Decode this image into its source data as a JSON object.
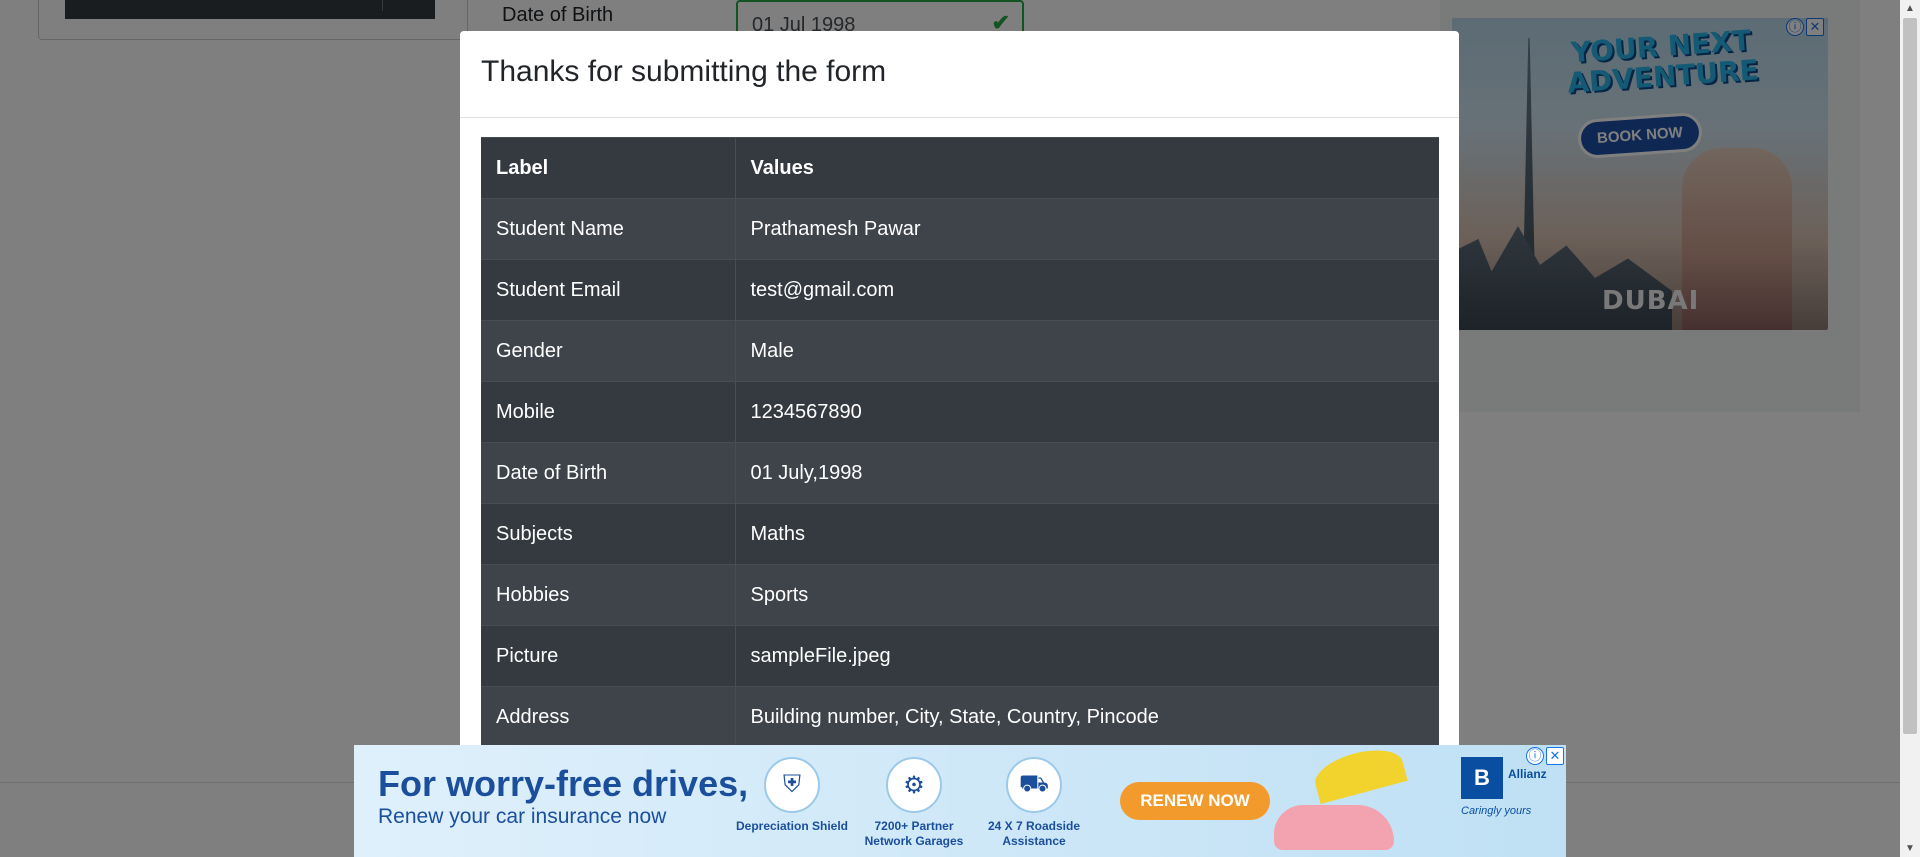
{
  "background": {
    "field_label": "Date of Birth",
    "date_value": "01 Jul 1998"
  },
  "modal": {
    "title": "Thanks for submitting the form",
    "table": {
      "headers": [
        "Label",
        "Values"
      ],
      "rows": [
        {
          "label": "Student Name",
          "value": "Prathamesh Pawar"
        },
        {
          "label": "Student Email",
          "value": "test@gmail.com"
        },
        {
          "label": "Gender",
          "value": "Male"
        },
        {
          "label": "Mobile",
          "value": "1234567890"
        },
        {
          "label": "Date of Birth",
          "value": "01 July,1998"
        },
        {
          "label": "Subjects",
          "value": "Maths"
        },
        {
          "label": "Hobbies",
          "value": "Sports"
        },
        {
          "label": "Picture",
          "value": "sampleFile.jpeg"
        },
        {
          "label": "Address",
          "value": "Building number, City, State, Country, Pincode"
        }
      ]
    }
  },
  "ad_right": {
    "headline": "YOUR NEXT ADVENTURE",
    "button": "BOOK NOW",
    "brand": "DUBAI"
  },
  "ad_bottom": {
    "headline": "For worry-free drives,",
    "subline": "Renew your car insurance now",
    "features": [
      "Depreciation Shield",
      "7200+ Partner Network Garages",
      "24 X 7 Roadside Assistance"
    ],
    "button": "RENEW NOW",
    "logo_text": "B",
    "partner": "Allianz",
    "tagline": "Caringly yours"
  },
  "icons": {
    "ad_info": "ⓘ",
    "ad_close": "✕",
    "check": "✔",
    "scroll_up": "▲",
    "scroll_down": "▼"
  },
  "colors": {
    "table_dark": "#343a40",
    "table_stripe": "#3e444a",
    "success": "#28a745",
    "renew_button": "#f39a2c",
    "ad_blue": "#1b4f9c"
  }
}
